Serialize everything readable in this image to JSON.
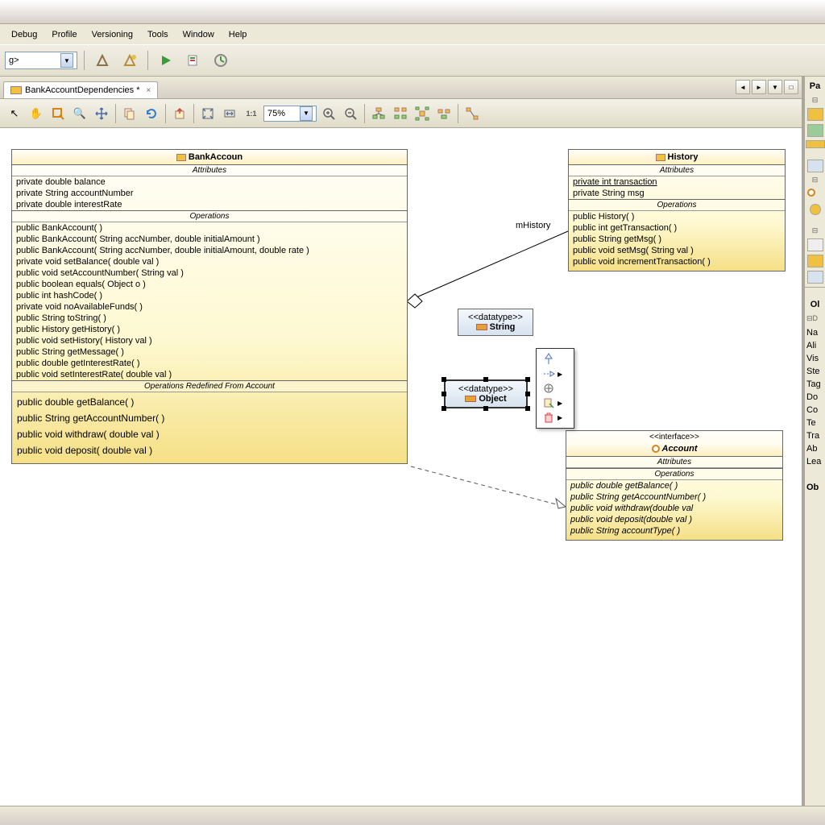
{
  "menu": [
    "Debug",
    "Profile",
    "Versioning",
    "Tools",
    "Window",
    "Help"
  ],
  "configCombo": "g>",
  "tab": {
    "title": "BankAccountDependencies *"
  },
  "zoom": "75%",
  "bankAccount": {
    "name": "BankAccoun",
    "attrLabel": "Attributes",
    "attrs": [
      "private double balance",
      "private String accountNumber",
      "private double interestRate"
    ],
    "opsLabel": "Operations",
    "ops": [
      "public  BankAccount(  )",
      "public  BankAccount( String accNumber, double initialAmount )",
      "public  BankAccount( String accNumber, double initialAmount, double rate )",
      "private void  setBalance( double val )",
      "public void  setAccountNumber( String val )",
      "public boolean  equals( Object o )",
      "public int  hashCode(  )",
      "private void  noAvailableFunds(  )",
      "public String  toString(  )",
      "public History  getHistory(  )",
      "public void  setHistory( History val )",
      "public String  getMessage(  )",
      "public double  getInterestRate(  )",
      "public void  setInterestRate( double val )"
    ],
    "redefLabel": "Operations Redefined From Account",
    "redef": [
      "public double  getBalance(  )",
      "public String  getAccountNumber(  )",
      "public void  withdraw( double val )",
      "public void  deposit( double val )"
    ]
  },
  "history": {
    "name": "History",
    "attrLabel": "Attributes",
    "attrs": [
      "private int transaction",
      "private String msg"
    ],
    "opsLabel": "Operations",
    "ops": [
      "public  History(  )",
      "public int  getTransaction(  )",
      "public String  getMsg(  )",
      "public void  setMsg( String val )",
      "public void  incrementTransaction(  )"
    ]
  },
  "account": {
    "stereotype": "<<interface>>",
    "name": "Account",
    "attrLabel": "Attributes",
    "opsLabel": "Operations",
    "ops": [
      "public double  getBalance(  )",
      "public String  getAccountNumber(  )",
      "public void  withdraw(double val",
      "public void  deposit(double val )",
      "public String  accountType(  )"
    ]
  },
  "stringType": {
    "stereotype": "<<datatype>>",
    "name": "String"
  },
  "objectType": {
    "stereotype": "<<datatype>>",
    "name": "Object"
  },
  "assocLabel": "mHistory",
  "rightHeader1": "Pa",
  "rightHeader2": "Ol",
  "props": [
    "Na",
    "Ali",
    "Vis",
    "Ste",
    "Tag",
    "Do",
    "Co",
    "Te",
    "Tra",
    "Ab",
    "Lea"
  ],
  "propsFooter": "Ob"
}
